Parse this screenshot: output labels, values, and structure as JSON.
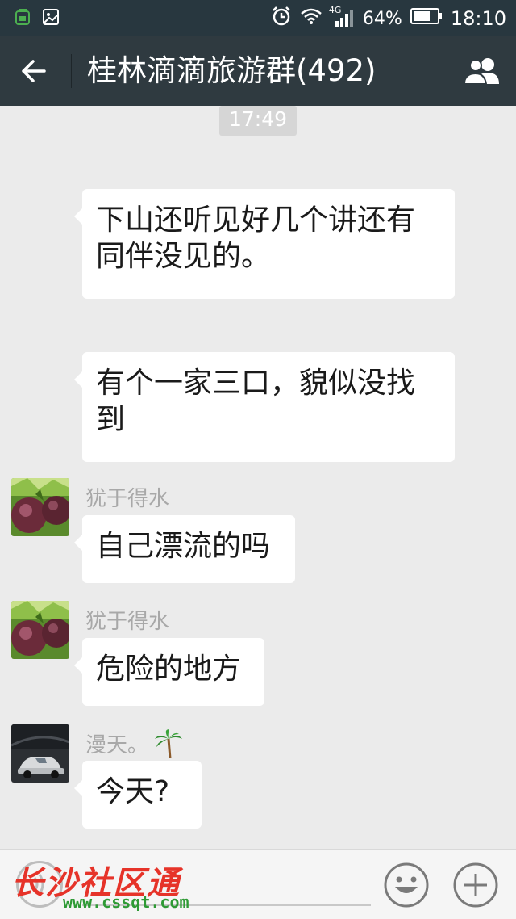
{
  "status_bar": {
    "network": "4G",
    "battery": "64%",
    "time": "18:10"
  },
  "header": {
    "title": "桂林滴滴旅游群(492)"
  },
  "chat": {
    "timestamp": "17:49",
    "messages": [
      {
        "sender": "",
        "text_lines": [
          "下山还听见好几个讲还有",
          "同伴没见的。"
        ]
      },
      {
        "sender": "",
        "text_lines": [
          "有个一家三口，貌似没找",
          "到"
        ]
      },
      {
        "sender": "犹于得水",
        "text_lines": [
          "自己漂流的吗"
        ]
      },
      {
        "sender": "犹于得水",
        "text_lines": [
          "危险的地方"
        ]
      },
      {
        "sender": "漫天。",
        "text_lines": [
          "今天?"
        ]
      }
    ]
  },
  "watermark": {
    "text": "长沙社区通",
    "url": "www.cssqt.com"
  },
  "icons": {
    "back": "back-arrow-icon",
    "members": "group-members-icon",
    "voice": "voice-icon",
    "emoji": "emoji-icon",
    "plus": "plus-icon"
  }
}
